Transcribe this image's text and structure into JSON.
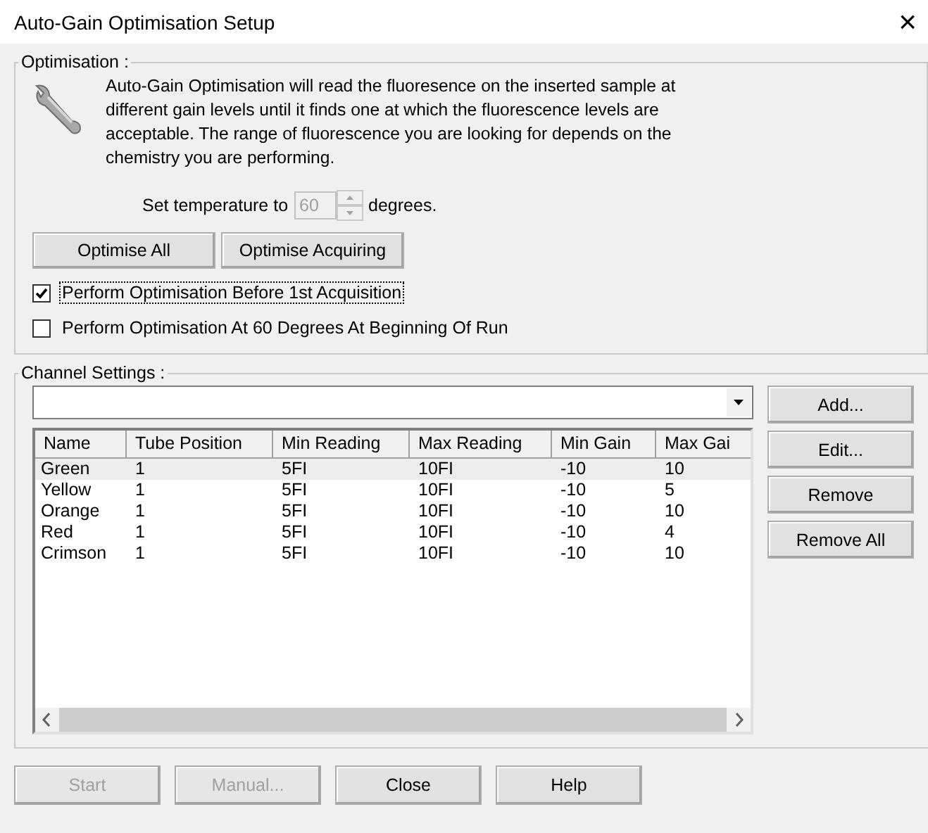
{
  "window": {
    "title": "Auto-Gain Optimisation Setup",
    "close": "×"
  },
  "optimisation": {
    "legend": "Optimisation :",
    "description": "Auto-Gain Optimisation will read the fluoresence on the inserted sample at different gain levels until it finds one at which the fluorescence levels are acceptable. The range of fluorescence you are looking for depends on the chemistry you are performing.",
    "temperature": {
      "label": "Set temperature to",
      "value": "60",
      "disabled": true,
      "unit": "degrees."
    },
    "buttons": [
      {
        "label": "Optimise All"
      },
      {
        "label": "Optimise Acquiring"
      }
    ],
    "checkboxes": [
      {
        "label": "Perform Optimisation Before 1st Acquisition",
        "checked": true,
        "focused": true
      },
      {
        "label": "Perform Optimisation At 60 Degrees At Beginning Of Run",
        "checked": false,
        "focused": false
      }
    ]
  },
  "channel_settings": {
    "legend": "Channel Settings :",
    "columns": [
      "Name",
      "Tube Position",
      "Min Reading",
      "Max Reading",
      "Min Gain",
      "Max Gai"
    ],
    "rows": [
      {
        "cells": [
          "Green",
          "1",
          "5FI",
          "10FI",
          "-10",
          "10"
        ],
        "selected": true
      },
      {
        "cells": [
          "Yellow",
          "1",
          "5FI",
          "10FI",
          "-10",
          "5"
        ],
        "selected": false
      },
      {
        "cells": [
          "Orange",
          "1",
          "5FI",
          "10FI",
          "-10",
          "10"
        ],
        "selected": false
      },
      {
        "cells": [
          "Red",
          "1",
          "5FI",
          "10FI",
          "-10",
          "4"
        ],
        "selected": false
      },
      {
        "cells": [
          "Crimson",
          "1",
          "5FI",
          "10FI",
          "-10",
          "10"
        ],
        "selected": false
      }
    ],
    "side_buttons": [
      {
        "label": "Add..."
      },
      {
        "label": "Edit..."
      },
      {
        "label": "Remove"
      },
      {
        "label": "Remove All"
      }
    ]
  },
  "footer_buttons": [
    {
      "label": "Start",
      "disabled": true
    },
    {
      "label": "Manual...",
      "disabled": true
    },
    {
      "label": "Close",
      "disabled": false
    },
    {
      "label": "Help",
      "disabled": false
    }
  ]
}
